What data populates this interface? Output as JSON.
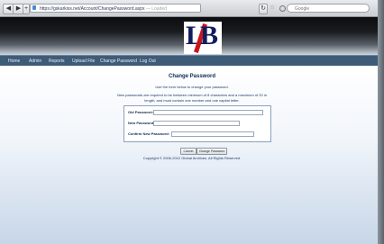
{
  "browser": {
    "url_prefix": "https://",
    "url": "gskarkiss.net/Account/ChangePassword.aspx",
    "url_tail": "— Loaded",
    "search_placeholder": "Google",
    "back": "◀",
    "forward": "▶",
    "reload": "↻",
    "add": "+",
    "star": "☆"
  },
  "logo": {
    "text_l": "L",
    "text_b": "B"
  },
  "nav": {
    "items": [
      "Home",
      "Admin",
      "Reports",
      "Upload File",
      "Change Password",
      "Log Out"
    ]
  },
  "page": {
    "title": "Change Password",
    "subtitle": "Use the form below to change your password.",
    "req_line1": "New passwords are required to be between minimum of 8 characters and a maximum of 20 in",
    "req_line2": "length, and must contain one number and one capital letter."
  },
  "form": {
    "old_label": "Old Password:",
    "new_label": "New Password:",
    "confirm_label": "Confirm New Password:",
    "old_value": "",
    "new_value": "",
    "confirm_value": ""
  },
  "buttons": {
    "cancel": "Cancel",
    "change": "Change Password"
  },
  "footer": {
    "copyright": "Copyright © 2006-2012 Global Archives. All Rights Reserved."
  }
}
